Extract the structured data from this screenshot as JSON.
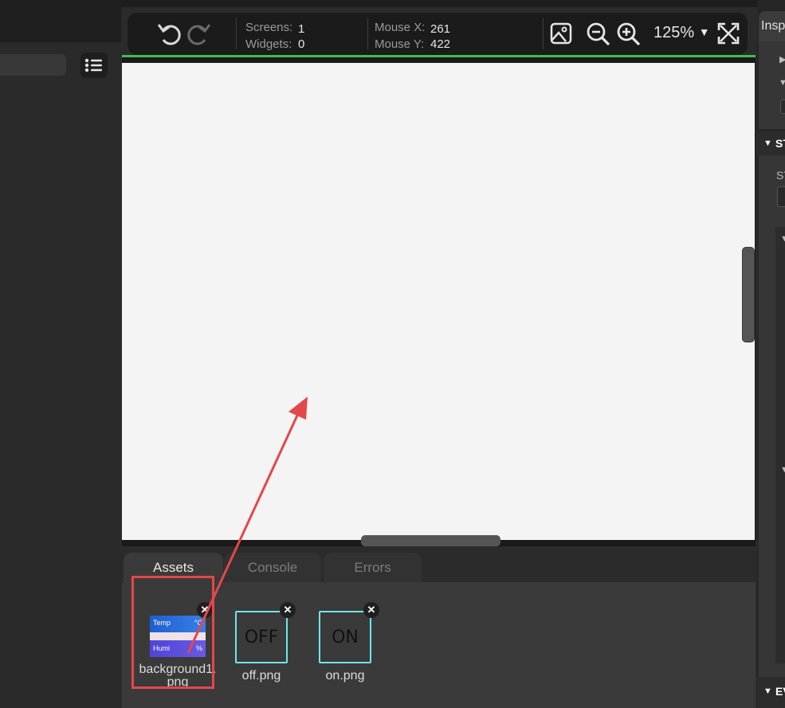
{
  "toolbar": {
    "screens_label": "Screens:",
    "screens_value": "1",
    "widgets_label": "Widgets:",
    "widgets_value": "0",
    "mouse_x_label": "Mouse X:",
    "mouse_x_value": "261",
    "mouse_y_label": "Mouse Y:",
    "mouse_y_value": "422",
    "zoom": "125%",
    "icons": [
      "undo-icon",
      "redo-icon",
      "image-icon",
      "zoom-out-icon",
      "zoom-in-icon",
      "dropdown-icon",
      "fullscreen-icon"
    ]
  },
  "bottom_tabs": [
    {
      "label": "Assets",
      "active": true
    },
    {
      "label": "Console",
      "active": false
    },
    {
      "label": "Errors",
      "active": false
    }
  ],
  "assets": [
    {
      "name_line1": "background1.",
      "name_line2": "png",
      "thumb_text_1": "Temp",
      "thumb_unit_1": "°C",
      "thumb_text_2": "Humi",
      "thumb_unit_2": "%"
    },
    {
      "name": "off.png",
      "thumb_text": "OFF"
    },
    {
      "name": "on.png",
      "thumb_text": "ON"
    }
  ],
  "inspector": {
    "tab_label": "Insp",
    "section_st": "ST",
    "row_st_label": "ST",
    "section_ev": "EV"
  },
  "colors": {
    "accent_green": "#3fbf4f",
    "asset_border": "#6fe6ec",
    "annotation_red": "#e4474b",
    "canvas_bg": "#f5f4f4"
  }
}
